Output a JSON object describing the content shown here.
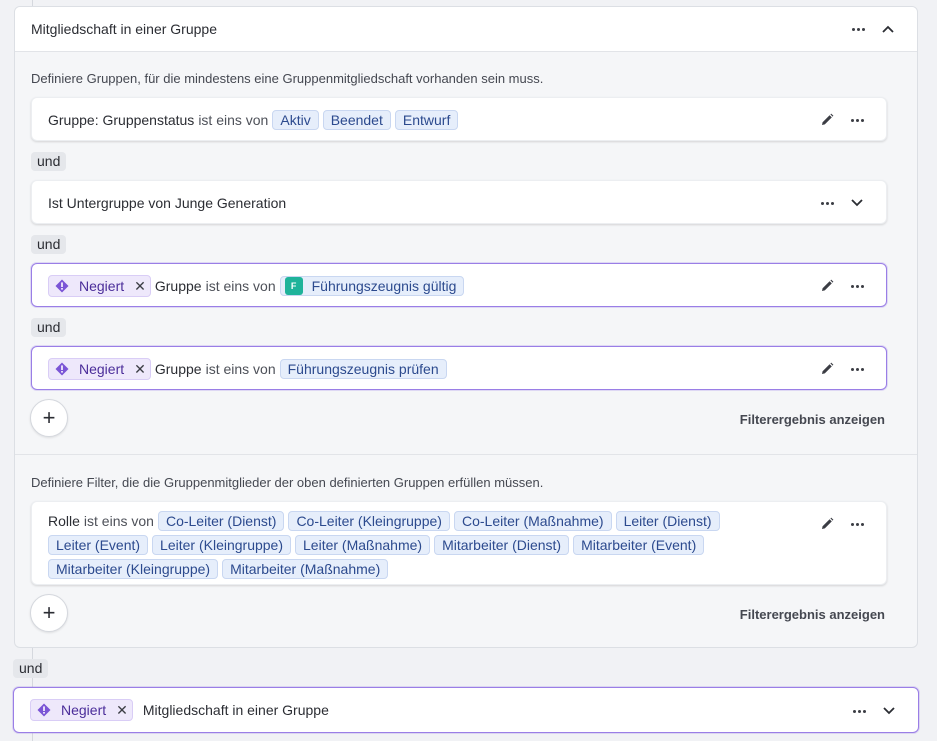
{
  "group_block": {
    "title": "Mitgliedschaft in einer Gruppe",
    "groups_hint": "Definiere Gruppen, für die mindestens eine Gruppenmitgliedschaft vorhanden sein muss.",
    "conditions": [
      {
        "label": "Gruppe: Gruppenstatus",
        "operator": "ist eins von",
        "values": [
          "Aktiv",
          "Beendet",
          "Entwurf"
        ]
      },
      {
        "label": "Ist Untergruppe von Junge Generation"
      },
      {
        "negated": "Negiert",
        "label": "Gruppe",
        "operator": "ist eins von",
        "values": [
          "Führungszeugnis gültig"
        ],
        "value_icon_letter": "F"
      },
      {
        "negated": "Negiert",
        "label": "Gruppe",
        "operator": "ist eins von",
        "values": [
          "Führungszeugnis prüfen"
        ]
      }
    ],
    "connector": "und",
    "show_result": "Filterergebnis anzeigen",
    "members_hint": "Definiere Filter, die die Gruppenmitglieder der oben definierten Gruppen erfüllen müssen.",
    "role_condition": {
      "label": "Rolle",
      "operator": "ist eins von",
      "values": [
        "Co-Leiter (Dienst)",
        "Co-Leiter (Kleingruppe)",
        "Co-Leiter (Maßnahme)",
        "Leiter (Dienst)",
        "Leiter (Event)",
        "Leiter (Kleingruppe)",
        "Leiter (Maßnahme)",
        "Mitarbeiter (Dienst)",
        "Mitarbeiter (Event)",
        "Mitarbeiter (Kleingruppe)",
        "Mitarbeiter (Maßnahme)"
      ]
    }
  },
  "outer_connector": "und",
  "bottom_block": {
    "negated": "Negiert",
    "title": "Mitgliedschaft in einer Gruppe"
  },
  "icons": {
    "more": "more-horizontal-icon",
    "collapse": "chevron-up-icon",
    "expand": "chevron-down-icon",
    "edit": "pencil-icon",
    "negated": "negation-diamond-icon",
    "remove": "close-icon",
    "add": "plus-icon"
  },
  "colors": {
    "accent_purple": "#9a7ee6",
    "chip_blue": "#e6eefb",
    "chip_teal": "#1fb39a"
  }
}
